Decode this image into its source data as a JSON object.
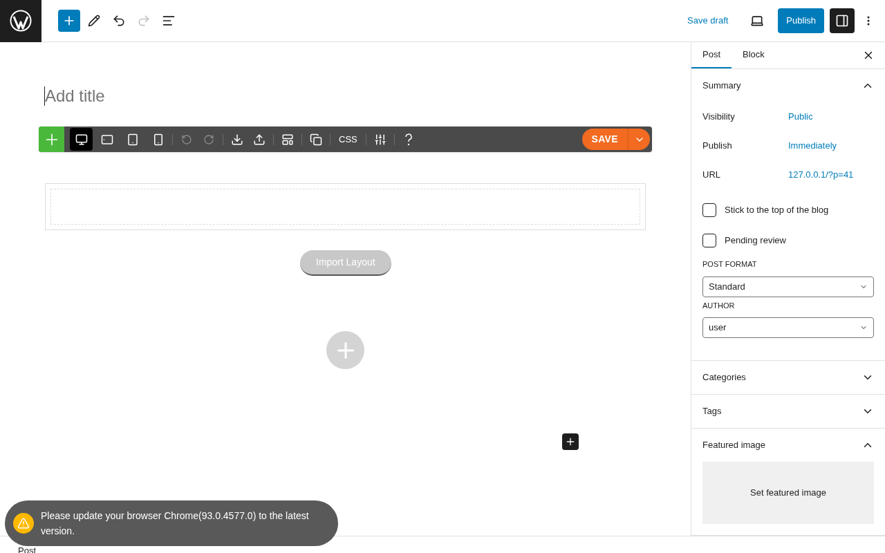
{
  "header": {
    "tools": [
      {
        "kind": "add",
        "disabled": false
      },
      {
        "kind": "edit",
        "disabled": false
      },
      {
        "kind": "undo",
        "disabled": false
      },
      {
        "kind": "redo",
        "disabled": true
      },
      {
        "kind": "outline",
        "disabled": false
      }
    ],
    "save_draft": "Save draft",
    "publish": "Publish",
    "settings_open": true
  },
  "editor": {
    "title_placeholder": "Add title",
    "builder_toolbar": {
      "views": [
        {
          "kind": "desktop",
          "selected": true
        },
        {
          "kind": "tablet-landscape",
          "selected": false
        },
        {
          "kind": "tablet",
          "selected": false
        },
        {
          "kind": "phone",
          "selected": false
        }
      ],
      "css_label": "CSS",
      "save_label": "SAVE"
    },
    "import_button": "Import Layout"
  },
  "sidebar": {
    "tabs": [
      {
        "label": "Post",
        "selected": true
      },
      {
        "label": "Block",
        "selected": false
      }
    ],
    "summary": {
      "title": "Summary",
      "expanded": true,
      "rows": [
        {
          "label": "Visibility",
          "value": "Public"
        },
        {
          "label": "Publish",
          "value": "Immediately"
        },
        {
          "label": "URL",
          "value": "127.0.0.1/?p=41"
        }
      ],
      "checkboxes": [
        {
          "label": "Stick to the top of the blog",
          "checked": false
        },
        {
          "label": "Pending review",
          "checked": false
        }
      ],
      "selects": [
        {
          "label": "POST FORMAT",
          "value": "Standard"
        },
        {
          "label": "AUTHOR",
          "value": "user"
        }
      ]
    },
    "panels": [
      {
        "title": "Categories",
        "expanded": false
      },
      {
        "title": "Tags",
        "expanded": false
      },
      {
        "title": "Featured image",
        "expanded": true,
        "button": "Set featured image"
      }
    ]
  },
  "footer": {
    "breadcrumb": "Post"
  },
  "notice": {
    "text": "Please update your browser Chrome(93.0.4577.0) to the latest version."
  }
}
